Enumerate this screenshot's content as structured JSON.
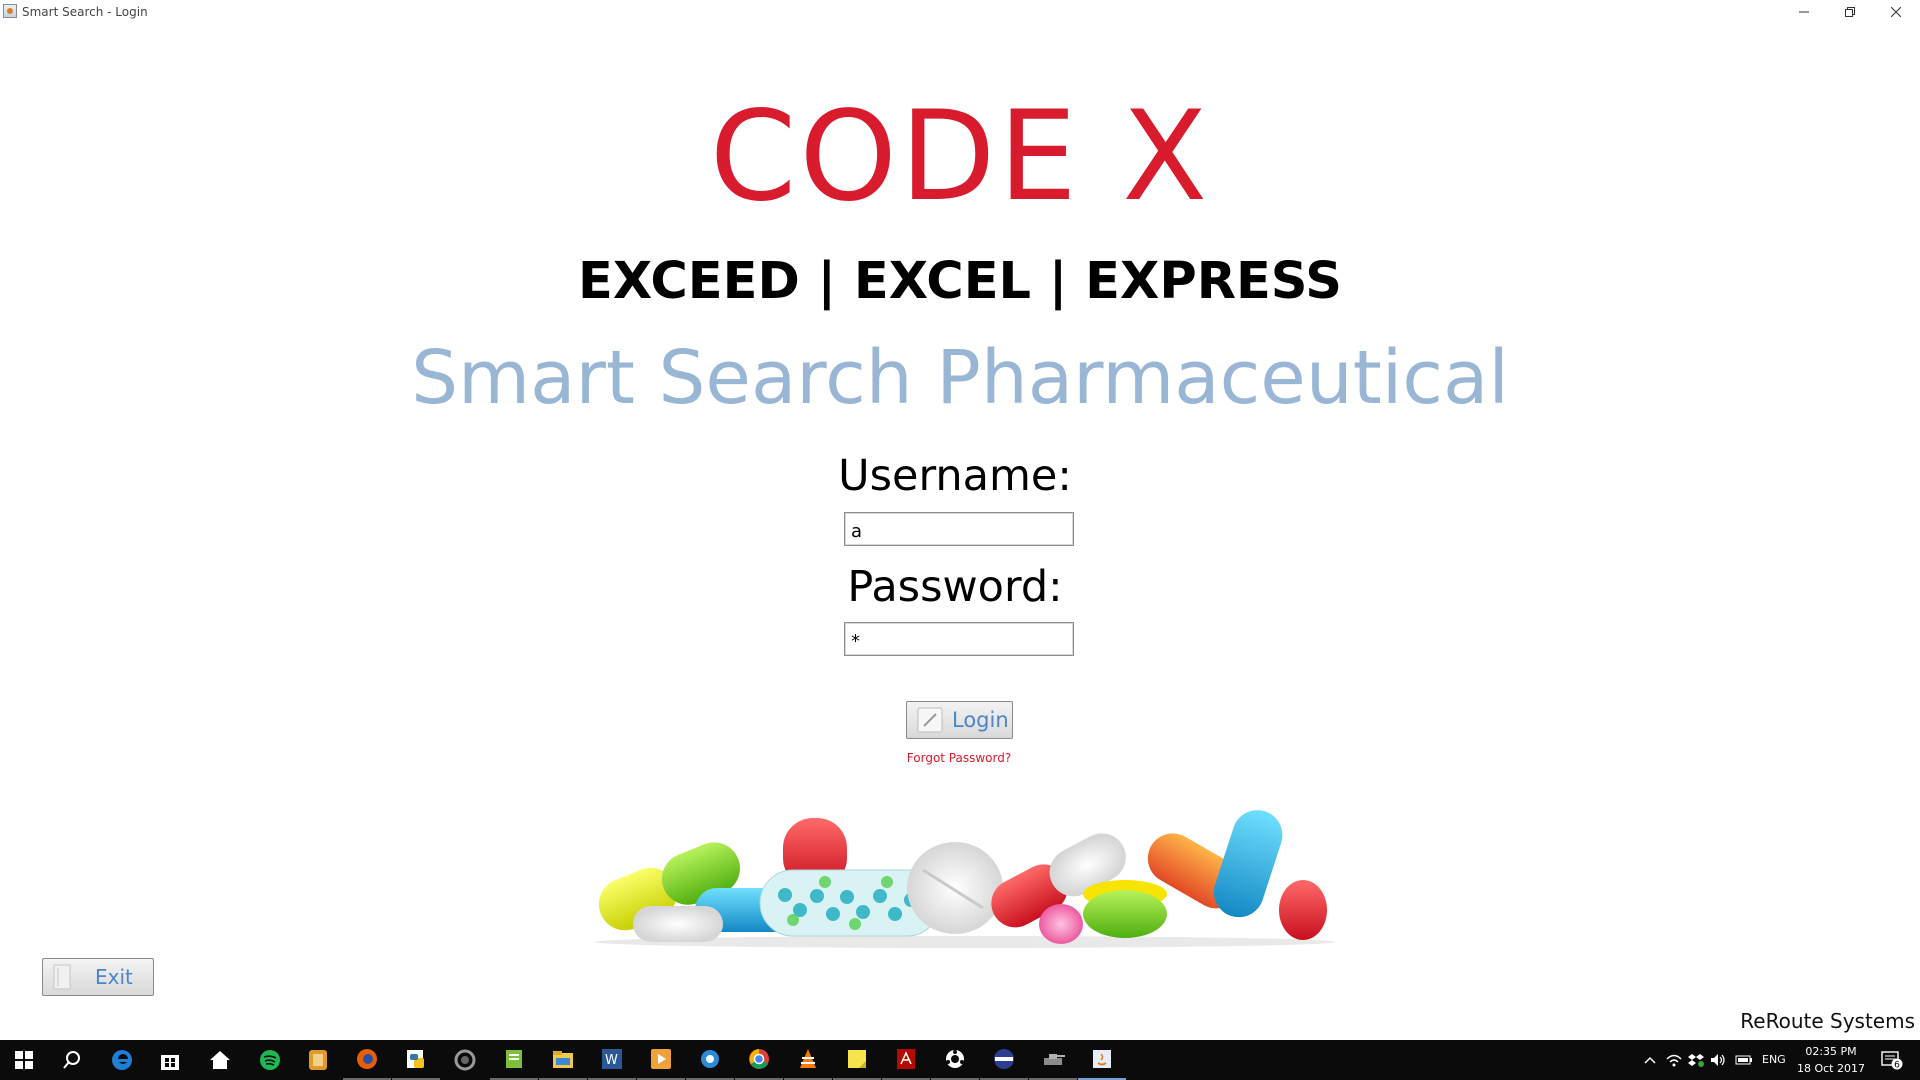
{
  "window": {
    "title": "Smart Search - Login",
    "controls": [
      "minimize",
      "restore",
      "close"
    ]
  },
  "brand": {
    "title": "CODE X",
    "tagline": "EXCEED | EXCEL | EXPRESS",
    "subtitle": "Smart Search Pharmaceutical",
    "title_color": "#d91b2e",
    "subtitle_color": "#9ab6d5"
  },
  "form": {
    "username_label": "Username:",
    "username_value": "a",
    "password_label": "Password:",
    "password_value": "*",
    "login_label": "Login",
    "forgot_label": "Forgot Password?"
  },
  "footer": {
    "exit_label": "Exit",
    "company": "ReRoute Systems"
  },
  "taskbar": {
    "items": [
      "start-icon",
      "search-icon",
      "edge-icon",
      "store-icon",
      "home-icon",
      "spotify-icon",
      "app-icon",
      "firefox-icon",
      "python-icon",
      "cortana-ring-icon",
      "notepad-icon",
      "file-explorer-icon",
      "word-icon",
      "media-player-icon",
      "tencent-icon",
      "chrome-icon",
      "vlc-icon",
      "sticky-notes-icon",
      "acrobat-icon",
      "daemon-icon",
      "stripe-icon",
      "tank-icon",
      "java-icon"
    ],
    "tray": {
      "language": "ENG",
      "time": "02:35 PM",
      "date": "18 Oct 2017",
      "notification_count": "6"
    },
    "accent": "#7a9fd4"
  }
}
